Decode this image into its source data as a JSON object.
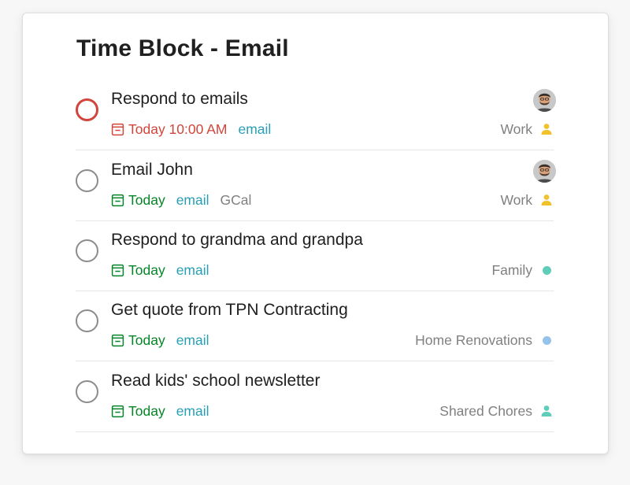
{
  "page": {
    "title": "Time Block - Email"
  },
  "colors": {
    "priority1": "#d1453b",
    "due_today": "#058527",
    "overdue": "#d1453b",
    "label": "#299fb5",
    "work_project": "#f2c12e",
    "family_project": "#5fcdb9",
    "home_project": "#96c3eb",
    "shared_chores_project": "#5fcdb9"
  },
  "tasks": [
    {
      "title": "Respond to emails",
      "due": "Today 10:00 AM",
      "labels": [
        "email"
      ],
      "project": "Work",
      "project_icon": "person-icon",
      "assignee": "avatar"
    },
    {
      "title": "Email John",
      "due": "Today",
      "labels": [
        "email",
        "GCal"
      ],
      "project": "Work",
      "project_icon": "person-icon",
      "assignee": "avatar"
    },
    {
      "title": "Respond to grandma and grandpa",
      "due": "Today",
      "labels": [
        "email"
      ],
      "project": "Family",
      "project_icon": "dot-icon"
    },
    {
      "title": "Get quote from TPN Contracting",
      "due": "Today",
      "labels": [
        "email"
      ],
      "project": "Home Renovations",
      "project_icon": "dot-icon"
    },
    {
      "title": "Read kids' school newsletter",
      "due": "Today",
      "labels": [
        "email"
      ],
      "project": "Shared Chores",
      "project_icon": "person-icon"
    }
  ]
}
